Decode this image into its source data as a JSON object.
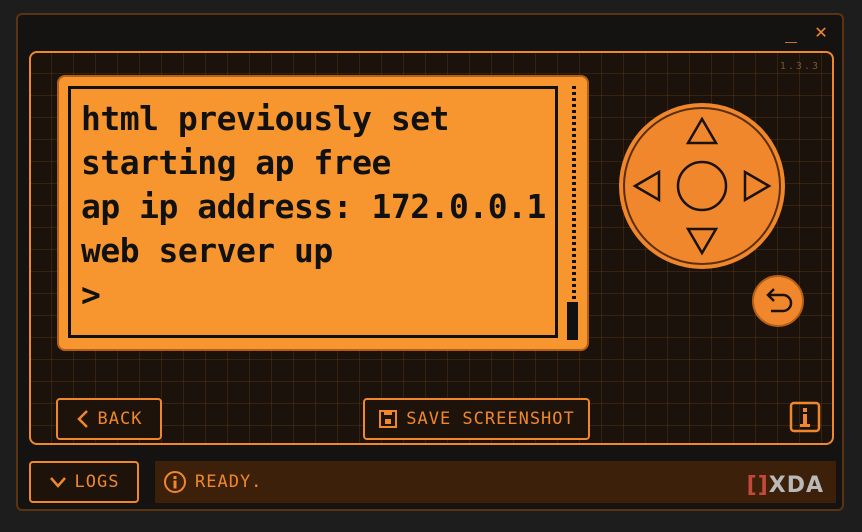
{
  "window": {
    "minimize_glyph": "_",
    "close_glyph": "✕"
  },
  "version": "1.3.3",
  "terminal": {
    "lines": [
      "html previously set",
      "starting ap free",
      "ap ip address: 172.0.0.1",
      "web server up",
      ">"
    ]
  },
  "controls": {
    "dpad_icons": [
      "up-arrow-icon",
      "left-arrow-icon",
      "center-button-icon",
      "right-arrow-icon",
      "down-arrow-icon"
    ],
    "undo_icon": "undo-icon"
  },
  "buttons": {
    "back_label": "BACK",
    "save_screenshot_label": "SAVE SCREENSHOT",
    "logs_label": "LOGS"
  },
  "status": {
    "text": "READY."
  },
  "watermark": {
    "brackets": "[]",
    "text": "XDA"
  },
  "colors": {
    "accent": "#f0872c",
    "screen": "#f7962e",
    "background": "#151311",
    "status_bg": "#3d200a"
  }
}
